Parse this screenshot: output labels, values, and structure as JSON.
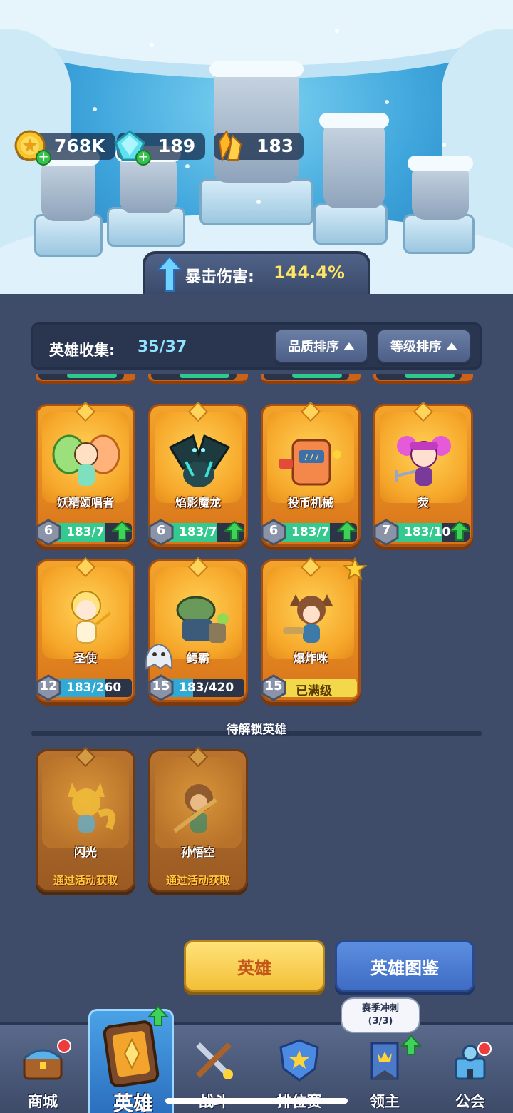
{
  "resources": {
    "gold": "768K",
    "gems": "189",
    "crystals": "183"
  },
  "crit_banner": {
    "label": "暴击伤害:",
    "value": "144.4%"
  },
  "collection": {
    "label": "英雄收集:",
    "count": "35/37",
    "sort_quality": "品质排序",
    "sort_level": "等级排序"
  },
  "heroes": [
    {
      "name": "妖精颂唱者",
      "level": "6",
      "progress": "183/7",
      "fill": 0.7,
      "upgradable": true
    },
    {
      "name": "焰影魔龙",
      "level": "6",
      "progress": "183/7",
      "fill": 0.7,
      "upgradable": true
    },
    {
      "name": "投币机械",
      "level": "6",
      "progress": "183/7",
      "fill": 0.7,
      "upgradable": true
    },
    {
      "name": "荧",
      "level": "7",
      "progress": "183/10",
      "fill": 0.7,
      "upgradable": true
    },
    {
      "name": "圣使",
      "level": "12",
      "progress": "183/260",
      "fill": 0.7
    },
    {
      "name": "鳄霸",
      "level": "15",
      "progress": "183/420",
      "fill": 0.44
    },
    {
      "name": "爆炸咪",
      "level": "15",
      "progress": "已满级",
      "fill": 1.0,
      "maxed": true
    }
  ],
  "locked_section": {
    "title": "待解锁英雄",
    "heroes": [
      {
        "name": "闪光",
        "how": "通过活动获取"
      },
      {
        "name": "孙悟空",
        "how": "通过活动获取"
      }
    ]
  },
  "buttons": {
    "hero": "英雄",
    "codex": "英雄图鉴"
  },
  "bubble": {
    "line1": "赛季冲刺",
    "line2": "(3/3)"
  },
  "nav": [
    {
      "label": "商城"
    },
    {
      "label": "英雄"
    },
    {
      "label": "战斗"
    },
    {
      "label": "排位赛"
    },
    {
      "label": "领主"
    },
    {
      "label": "公会"
    }
  ],
  "colors": {
    "accent_gold": "#ffe566",
    "count_blue": "#8fe3ff",
    "progress_green": "#33c98f",
    "card_orange": "#f3a42c"
  }
}
